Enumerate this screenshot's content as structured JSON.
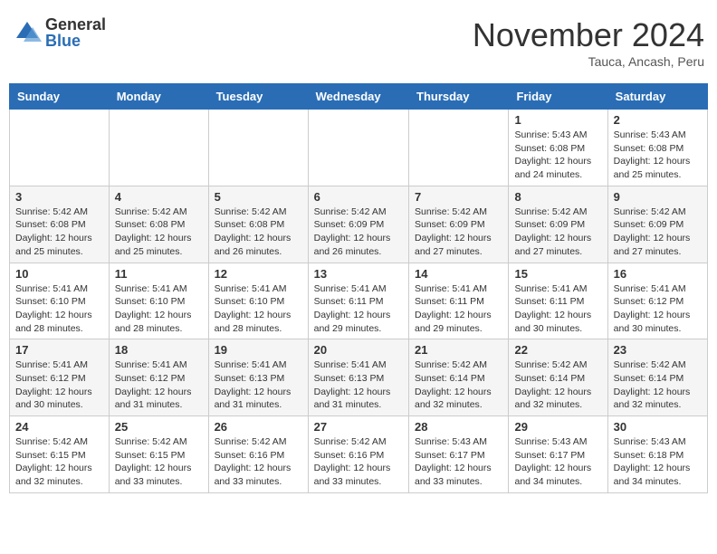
{
  "logo": {
    "general": "General",
    "blue": "Blue"
  },
  "title": "November 2024",
  "location": "Tauca, Ancash, Peru",
  "weekdays": [
    "Sunday",
    "Monday",
    "Tuesday",
    "Wednesday",
    "Thursday",
    "Friday",
    "Saturday"
  ],
  "weeks": [
    [
      {
        "day": "",
        "info": ""
      },
      {
        "day": "",
        "info": ""
      },
      {
        "day": "",
        "info": ""
      },
      {
        "day": "",
        "info": ""
      },
      {
        "day": "",
        "info": ""
      },
      {
        "day": "1",
        "info": "Sunrise: 5:43 AM\nSunset: 6:08 PM\nDaylight: 12 hours and 24 minutes."
      },
      {
        "day": "2",
        "info": "Sunrise: 5:43 AM\nSunset: 6:08 PM\nDaylight: 12 hours and 25 minutes."
      }
    ],
    [
      {
        "day": "3",
        "info": "Sunrise: 5:42 AM\nSunset: 6:08 PM\nDaylight: 12 hours and 25 minutes."
      },
      {
        "day": "4",
        "info": "Sunrise: 5:42 AM\nSunset: 6:08 PM\nDaylight: 12 hours and 25 minutes."
      },
      {
        "day": "5",
        "info": "Sunrise: 5:42 AM\nSunset: 6:08 PM\nDaylight: 12 hours and 26 minutes."
      },
      {
        "day": "6",
        "info": "Sunrise: 5:42 AM\nSunset: 6:09 PM\nDaylight: 12 hours and 26 minutes."
      },
      {
        "day": "7",
        "info": "Sunrise: 5:42 AM\nSunset: 6:09 PM\nDaylight: 12 hours and 27 minutes."
      },
      {
        "day": "8",
        "info": "Sunrise: 5:42 AM\nSunset: 6:09 PM\nDaylight: 12 hours and 27 minutes."
      },
      {
        "day": "9",
        "info": "Sunrise: 5:42 AM\nSunset: 6:09 PM\nDaylight: 12 hours and 27 minutes."
      }
    ],
    [
      {
        "day": "10",
        "info": "Sunrise: 5:41 AM\nSunset: 6:10 PM\nDaylight: 12 hours and 28 minutes."
      },
      {
        "day": "11",
        "info": "Sunrise: 5:41 AM\nSunset: 6:10 PM\nDaylight: 12 hours and 28 minutes."
      },
      {
        "day": "12",
        "info": "Sunrise: 5:41 AM\nSunset: 6:10 PM\nDaylight: 12 hours and 28 minutes."
      },
      {
        "day": "13",
        "info": "Sunrise: 5:41 AM\nSunset: 6:11 PM\nDaylight: 12 hours and 29 minutes."
      },
      {
        "day": "14",
        "info": "Sunrise: 5:41 AM\nSunset: 6:11 PM\nDaylight: 12 hours and 29 minutes."
      },
      {
        "day": "15",
        "info": "Sunrise: 5:41 AM\nSunset: 6:11 PM\nDaylight: 12 hours and 30 minutes."
      },
      {
        "day": "16",
        "info": "Sunrise: 5:41 AM\nSunset: 6:12 PM\nDaylight: 12 hours and 30 minutes."
      }
    ],
    [
      {
        "day": "17",
        "info": "Sunrise: 5:41 AM\nSunset: 6:12 PM\nDaylight: 12 hours and 30 minutes."
      },
      {
        "day": "18",
        "info": "Sunrise: 5:41 AM\nSunset: 6:12 PM\nDaylight: 12 hours and 31 minutes."
      },
      {
        "day": "19",
        "info": "Sunrise: 5:41 AM\nSunset: 6:13 PM\nDaylight: 12 hours and 31 minutes."
      },
      {
        "day": "20",
        "info": "Sunrise: 5:41 AM\nSunset: 6:13 PM\nDaylight: 12 hours and 31 minutes."
      },
      {
        "day": "21",
        "info": "Sunrise: 5:42 AM\nSunset: 6:14 PM\nDaylight: 12 hours and 32 minutes."
      },
      {
        "day": "22",
        "info": "Sunrise: 5:42 AM\nSunset: 6:14 PM\nDaylight: 12 hours and 32 minutes."
      },
      {
        "day": "23",
        "info": "Sunrise: 5:42 AM\nSunset: 6:14 PM\nDaylight: 12 hours and 32 minutes."
      }
    ],
    [
      {
        "day": "24",
        "info": "Sunrise: 5:42 AM\nSunset: 6:15 PM\nDaylight: 12 hours and 32 minutes."
      },
      {
        "day": "25",
        "info": "Sunrise: 5:42 AM\nSunset: 6:15 PM\nDaylight: 12 hours and 33 minutes."
      },
      {
        "day": "26",
        "info": "Sunrise: 5:42 AM\nSunset: 6:16 PM\nDaylight: 12 hours and 33 minutes."
      },
      {
        "day": "27",
        "info": "Sunrise: 5:42 AM\nSunset: 6:16 PM\nDaylight: 12 hours and 33 minutes."
      },
      {
        "day": "28",
        "info": "Sunrise: 5:43 AM\nSunset: 6:17 PM\nDaylight: 12 hours and 33 minutes."
      },
      {
        "day": "29",
        "info": "Sunrise: 5:43 AM\nSunset: 6:17 PM\nDaylight: 12 hours and 34 minutes."
      },
      {
        "day": "30",
        "info": "Sunrise: 5:43 AM\nSunset: 6:18 PM\nDaylight: 12 hours and 34 minutes."
      }
    ]
  ]
}
